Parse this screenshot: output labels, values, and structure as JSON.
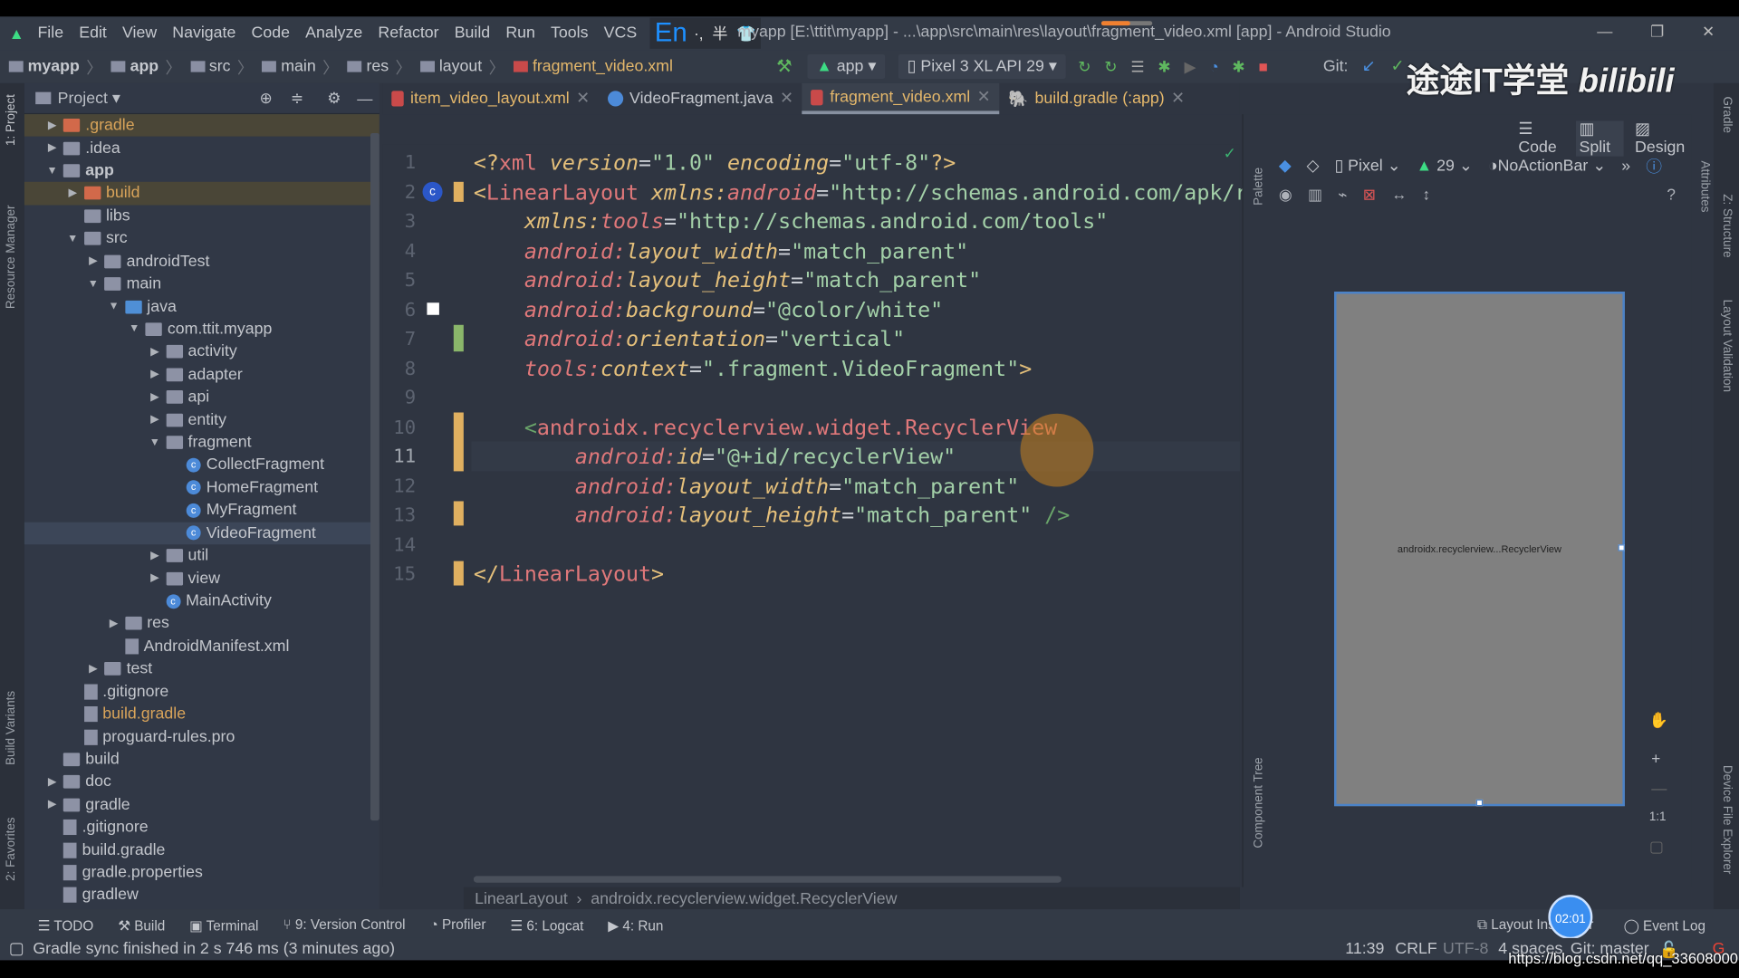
{
  "menu": [
    "File",
    "Edit",
    "View",
    "Navigate",
    "Code",
    "Analyze",
    "Refactor",
    "Build",
    "Run",
    "Tools",
    "VCS"
  ],
  "ime": {
    "lang": "En",
    "punct": "·,",
    "width": "半"
  },
  "window_title": "myapp [E:\\ttit\\myapp] - ...\\app\\src\\main\\res\\layout\\fragment_video.xml [app] - Android Studio",
  "breadcrumb": [
    "myapp",
    "app",
    "src",
    "main",
    "res",
    "layout",
    "fragment_video.xml"
  ],
  "toolbar": {
    "run_config": "app",
    "device": "Pixel 3 XL API 29",
    "git_label": "Git:"
  },
  "watermark": "途途IT学堂 bilibili",
  "project_panel": {
    "title": "Project",
    "side_tabs": [
      "1: Project",
      "Resource Manager",
      "Build Variants",
      "2: Favorites"
    ]
  },
  "tree": [
    {
      "label": ".gradle",
      "depth": 1,
      "arrow": "right",
      "icon": "folder-orange",
      "mark": true,
      "color": "#d9a45a"
    },
    {
      "label": ".idea",
      "depth": 1,
      "arrow": "right",
      "icon": "folder"
    },
    {
      "label": "app",
      "depth": 1,
      "arrow": "down",
      "icon": "folder",
      "bold": true
    },
    {
      "label": "build",
      "depth": 2,
      "arrow": "right",
      "icon": "folder-orange",
      "mark": true,
      "color": "#d9a45a"
    },
    {
      "label": "libs",
      "depth": 2,
      "icon": "folder"
    },
    {
      "label": "src",
      "depth": 2,
      "arrow": "down",
      "icon": "folder"
    },
    {
      "label": "androidTest",
      "depth": 3,
      "arrow": "right",
      "icon": "folder"
    },
    {
      "label": "main",
      "depth": 3,
      "arrow": "down",
      "icon": "folder"
    },
    {
      "label": "java",
      "depth": 4,
      "arrow": "down",
      "icon": "folder-blue"
    },
    {
      "label": "com.ttit.myapp",
      "depth": 5,
      "arrow": "down",
      "icon": "folder"
    },
    {
      "label": "activity",
      "depth": 6,
      "arrow": "right",
      "icon": "folder"
    },
    {
      "label": "adapter",
      "depth": 6,
      "arrow": "right",
      "icon": "folder"
    },
    {
      "label": "api",
      "depth": 6,
      "arrow": "right",
      "icon": "folder"
    },
    {
      "label": "entity",
      "depth": 6,
      "arrow": "right",
      "icon": "folder"
    },
    {
      "label": "fragment",
      "depth": 6,
      "arrow": "down",
      "icon": "folder"
    },
    {
      "label": "CollectFragment",
      "depth": 7,
      "icon": "class"
    },
    {
      "label": "HomeFragment",
      "depth": 7,
      "icon": "class"
    },
    {
      "label": "MyFragment",
      "depth": 7,
      "icon": "class"
    },
    {
      "label": "VideoFragment",
      "depth": 7,
      "icon": "class",
      "selected": true
    },
    {
      "label": "util",
      "depth": 6,
      "arrow": "right",
      "icon": "folder"
    },
    {
      "label": "view",
      "depth": 6,
      "arrow": "right",
      "icon": "folder"
    },
    {
      "label": "MainActivity",
      "depth": 6,
      "icon": "class"
    },
    {
      "label": "res",
      "depth": 4,
      "arrow": "right",
      "icon": "folder"
    },
    {
      "label": "AndroidManifest.xml",
      "depth": 4,
      "icon": "file"
    },
    {
      "label": "test",
      "depth": 3,
      "arrow": "right",
      "icon": "folder"
    },
    {
      "label": ".gitignore",
      "depth": 2,
      "icon": "file"
    },
    {
      "label": "build.gradle",
      "depth": 2,
      "icon": "file",
      "color": "#d9a45a"
    },
    {
      "label": "proguard-rules.pro",
      "depth": 2,
      "icon": "file"
    },
    {
      "label": "build",
      "depth": 1,
      "icon": "folder"
    },
    {
      "label": "doc",
      "depth": 1,
      "arrow": "right",
      "icon": "folder"
    },
    {
      "label": "gradle",
      "depth": 1,
      "arrow": "right",
      "icon": "folder"
    },
    {
      "label": ".gitignore",
      "depth": 1,
      "icon": "file"
    },
    {
      "label": "build.gradle",
      "depth": 1,
      "icon": "file"
    },
    {
      "label": "gradle.properties",
      "depth": 1,
      "icon": "file"
    },
    {
      "label": "gradlew",
      "depth": 1,
      "icon": "file"
    }
  ],
  "tabs": [
    {
      "label": "item_video_layout.xml",
      "active": false
    },
    {
      "label": "VideoFragment.java",
      "active": false
    },
    {
      "label": "fragment_video.xml",
      "active": true
    },
    {
      "label": "build.gradle (:app)",
      "active": false
    }
  ],
  "code_lines": [
    [
      [
        "br",
        "<?"
      ],
      [
        "tag",
        "xml "
      ],
      [
        "attr",
        "version"
      ],
      [
        "p",
        "="
      ],
      [
        "str",
        "\"1.0\" "
      ],
      [
        "attr",
        "encoding"
      ],
      [
        "p",
        "="
      ],
      [
        "str",
        "\"utf-8\""
      ],
      [
        "br",
        "?>"
      ]
    ],
    [
      [
        "br",
        "<"
      ],
      [
        "tag",
        "LinearLayout "
      ],
      [
        "attr",
        "xmlns:"
      ],
      [
        "ns",
        "android"
      ],
      [
        "p",
        "="
      ],
      [
        "str",
        "\"http://schemas.android.com/apk/r"
      ]
    ],
    [
      [
        "p",
        "    "
      ],
      [
        "attr",
        "xmlns:"
      ],
      [
        "ns",
        "tools"
      ],
      [
        "p",
        "="
      ],
      [
        "str",
        "\"http://schemas.android.com/tools\""
      ]
    ],
    [
      [
        "p",
        "    "
      ],
      [
        "ns",
        "android:"
      ],
      [
        "attr",
        "layout_width"
      ],
      [
        "p",
        "="
      ],
      [
        "str",
        "\"match_parent\""
      ]
    ],
    [
      [
        "p",
        "    "
      ],
      [
        "ns",
        "android:"
      ],
      [
        "attr",
        "layout_height"
      ],
      [
        "p",
        "="
      ],
      [
        "str",
        "\"match_parent\""
      ]
    ],
    [
      [
        "p",
        "    "
      ],
      [
        "ns",
        "android:"
      ],
      [
        "attr",
        "background"
      ],
      [
        "p",
        "="
      ],
      [
        "str",
        "\"@color/white\""
      ]
    ],
    [
      [
        "p",
        "    "
      ],
      [
        "ns",
        "android:"
      ],
      [
        "attr",
        "orientation"
      ],
      [
        "p",
        "="
      ],
      [
        "str",
        "\"vertical\""
      ]
    ],
    [
      [
        "p",
        "    "
      ],
      [
        "ns",
        "tools:"
      ],
      [
        "attr",
        "context"
      ],
      [
        "p",
        "="
      ],
      [
        "str",
        "\".fragment.VideoFragment\""
      ],
      [
        "br",
        ">"
      ]
    ],
    [],
    [
      [
        "p",
        "    "
      ],
      [
        "gr",
        "<"
      ],
      [
        "tag",
        "androidx.recyclerview.widget.RecyclerView"
      ]
    ],
    [
      [
        "p",
        "        "
      ],
      [
        "ns",
        "android:"
      ],
      [
        "attr",
        "id"
      ],
      [
        "p",
        "="
      ],
      [
        "str",
        "\"@+id/recyclerView\""
      ]
    ],
    [
      [
        "p",
        "        "
      ],
      [
        "ns",
        "android:"
      ],
      [
        "attr",
        "layout_width"
      ],
      [
        "p",
        "="
      ],
      [
        "str",
        "\"match_parent\""
      ]
    ],
    [
      [
        "p",
        "        "
      ],
      [
        "ns",
        "android:"
      ],
      [
        "attr",
        "layout_height"
      ],
      [
        "p",
        "="
      ],
      [
        "str",
        "\"match_parent\" "
      ],
      [
        "gr",
        "/>"
      ]
    ],
    [],
    [
      [
        "br",
        "</"
      ],
      [
        "tag",
        "LinearLayout"
      ],
      [
        "br",
        ">"
      ]
    ]
  ],
  "editor_breadcrumb": [
    "LinearLayout",
    "androidx.recyclerview.widget.RecyclerView"
  ],
  "design": {
    "modes": [
      "Code",
      "Split",
      "Design"
    ],
    "device": "Pixel",
    "api": "29",
    "theme": "NoActionBar",
    "preview_label": "androidx.recyclerview...RecyclerView",
    "palette": "Palette",
    "component_tree": "Component Tree",
    "zoom_label": "1:1"
  },
  "right_tabs": [
    "Gradle",
    "Attributes",
    "Z: Structure",
    "Layout Validation",
    "Device File Explorer"
  ],
  "bottom_tools": [
    "TODO",
    "Build",
    "Terminal",
    "9: Version Control",
    "Profiler",
    "6: Logcat",
    "4: Run"
  ],
  "bottom_right_tools": [
    "Layout Inspector",
    "Event Log"
  ],
  "timer": "02:01",
  "status": {
    "message": "Gradle sync finished in 2 s 746 ms (3 minutes ago)",
    "position": "11:39",
    "line_sep": "CRLF",
    "encoding": "UTF-8",
    "indent": "4 spaces",
    "git": "Git: master"
  },
  "url_watermark": "https://blog.csdn.net/qq_33608000"
}
